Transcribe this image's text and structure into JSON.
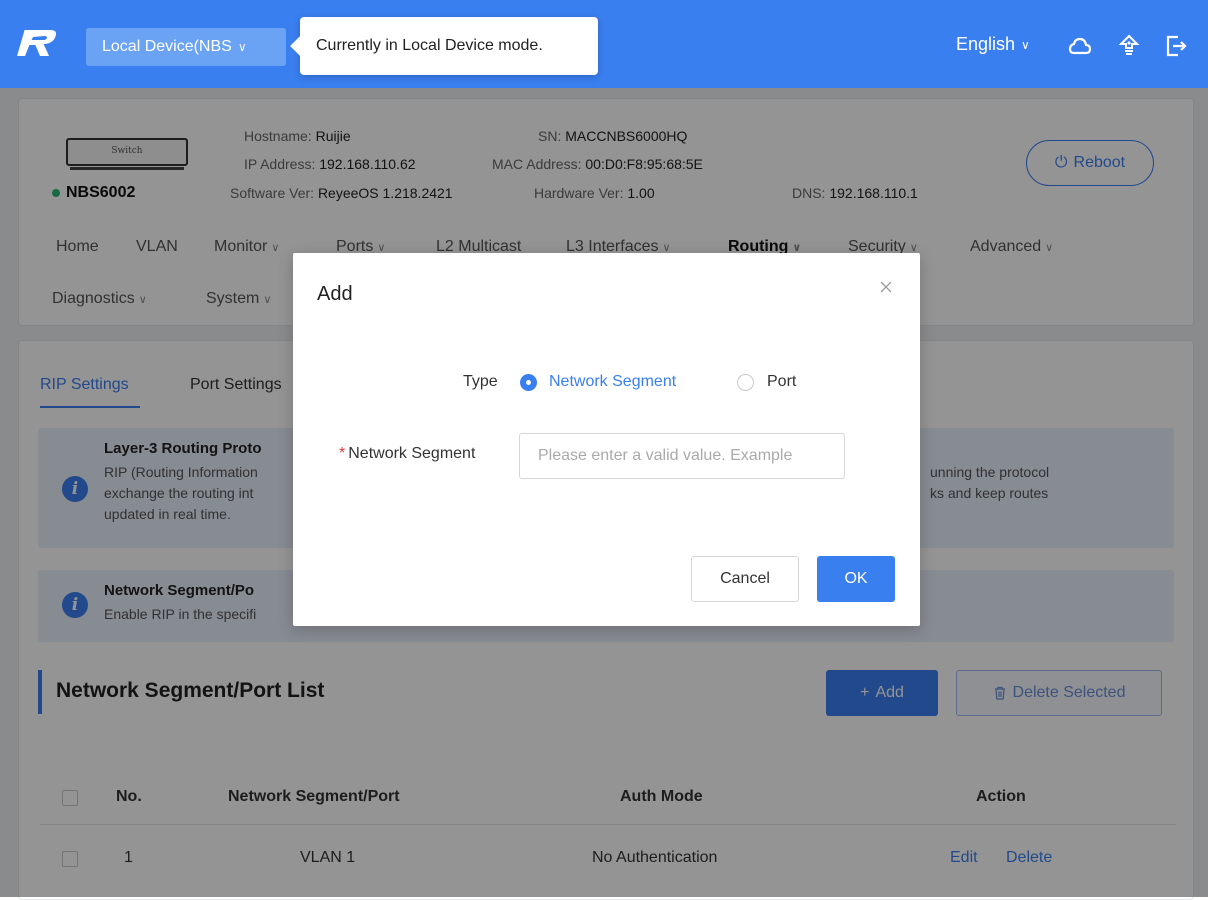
{
  "topbar": {
    "device_select": "Local Device(NBS",
    "tooltip": "Currently in Local Device mode.",
    "language": "English",
    "brand_color": "#3a7ff0"
  },
  "device": {
    "model_label": "Switch",
    "name": "NBS6002",
    "status_color": "#2bb673",
    "hostname_label": "Hostname:",
    "hostname": "Ruijie",
    "sn_label": "SN:",
    "sn": "MACCNBS6000HQ",
    "ip_label": "IP Address:",
    "ip": "192.168.110.62",
    "mac_label": "MAC Address:",
    "mac": "00:D0:F8:95:68:5E",
    "sw_label": "Software Ver:",
    "sw": "ReyeeOS 1.218.2421",
    "hw_label": "Hardware Ver:",
    "hw": "1.00",
    "dns_label": "DNS:",
    "dns": "192.168.110.1",
    "reboot_label": "Reboot"
  },
  "nav": [
    "Home",
    "VLAN",
    "Monitor",
    "Ports",
    "L2 Multicast",
    "L3 Interfaces",
    "Routing",
    "Security",
    "Advanced",
    "Diagnostics",
    "System"
  ],
  "tabs": [
    "RIP Settings",
    "Port Settings"
  ],
  "banners": [
    {
      "title": "Layer-3 Routing Proto",
      "line1a": "RIP (Routing Information",
      "line1b": "unning the protocol",
      "line2a": "exchange the routing int",
      "line2b": "ks and keep routes",
      "line3": "updated in real time."
    },
    {
      "title": "Network Segment/Po",
      "line1": "Enable RIP in the specifi"
    }
  ],
  "list": {
    "title": "Network Segment/Port List",
    "add_label": "Add",
    "delete_label": "Delete Selected",
    "columns": [
      "No.",
      "Network Segment/Port",
      "Auth Mode",
      "Action"
    ],
    "rows": [
      {
        "no": "1",
        "segment": "VLAN 1",
        "auth": "No Authentication",
        "edit": "Edit",
        "delete": "Delete"
      }
    ]
  },
  "modal": {
    "title": "Add",
    "type_label": "Type",
    "option_segment": "Network Segment",
    "option_port": "Port",
    "field_label": "Network Segment",
    "field_required": "*",
    "field_placeholder": "Please enter a valid value. Example",
    "cancel_label": "Cancel",
    "ok_label": "OK"
  }
}
